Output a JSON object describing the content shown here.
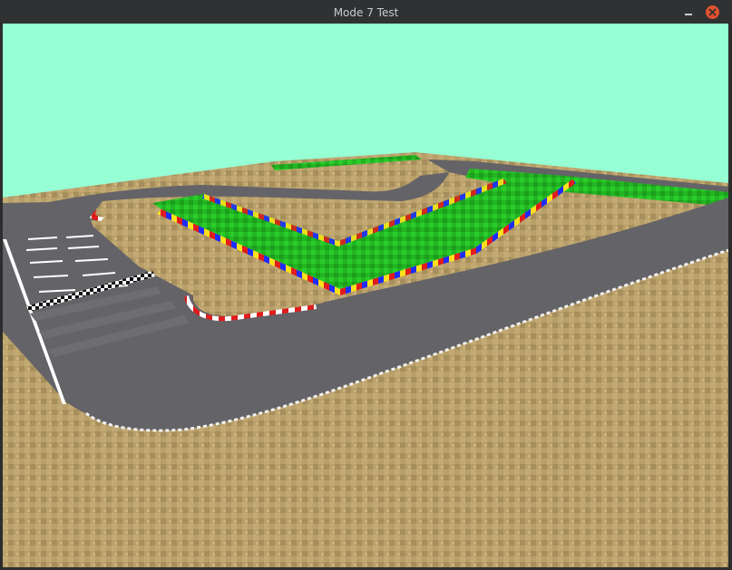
{
  "window": {
    "title": "Mode 7 Test",
    "controls": {
      "minimize_icon": "minimize-icon",
      "close_icon": "close-icon"
    }
  },
  "scene": {
    "sky_color": "#97ffd4",
    "ground_color": "#b9a06a",
    "track_color": "#646367",
    "grass_color": "#1ec21e",
    "curb_colors": [
      "#e21c1c",
      "#ffffff"
    ],
    "barrier_colors": [
      "#1e2cff",
      "#ffe11c",
      "#e21c1c"
    ]
  }
}
